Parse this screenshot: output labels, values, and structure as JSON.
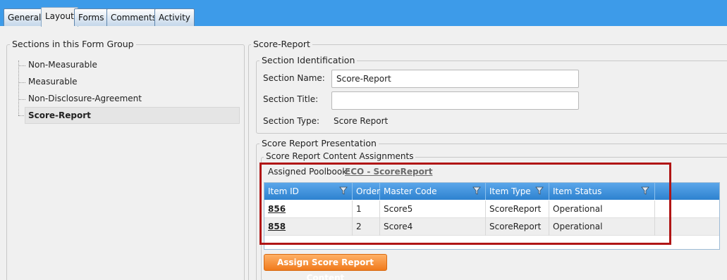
{
  "tabs": [
    {
      "label": "General"
    },
    {
      "label": "Layout"
    },
    {
      "label": "Forms"
    },
    {
      "label": "Comments"
    },
    {
      "label": "Activity"
    }
  ],
  "left_panel": {
    "legend": "Sections in this Form Group",
    "items": [
      {
        "label": "Non-Measurable"
      },
      {
        "label": "Measurable"
      },
      {
        "label": "Non-Disclosure-Agreement"
      },
      {
        "label": "Score-Report"
      }
    ]
  },
  "right_panel": {
    "legend": "Score-Report",
    "identification": {
      "legend": "Section Identification",
      "section_name_label": "Section Name:",
      "section_name_value": "Score-Report",
      "section_title_label": "Section Title:",
      "section_title_value": "",
      "section_type_label": "Section Type:",
      "section_type_value": "Score Report"
    },
    "presentation": {
      "legend": "Score Report Presentation",
      "content_legend": "Score Report Content Assignments",
      "poolbook_label": "Assigned Poolbook:",
      "poolbook_link": "ECO - ScoreReport",
      "columns": [
        "Item ID",
        "Order",
        "Master Code",
        "Item Type",
        "Item Status"
      ],
      "rows": [
        {
          "item_id": "856",
          "order": "1",
          "master_code": "Score5",
          "item_type": "ScoreReport",
          "item_status": "Operational"
        },
        {
          "item_id": "858",
          "order": "2",
          "master_code": "Score4",
          "item_type": "ScoreReport",
          "item_status": "Operational"
        }
      ],
      "assign_button": "Assign Score Report Content"
    }
  },
  "colors": {
    "tab_bar": "#3d9be9",
    "grid_header": "#2e82cf",
    "highlight": "#b01515",
    "button": "#f07a1c"
  }
}
